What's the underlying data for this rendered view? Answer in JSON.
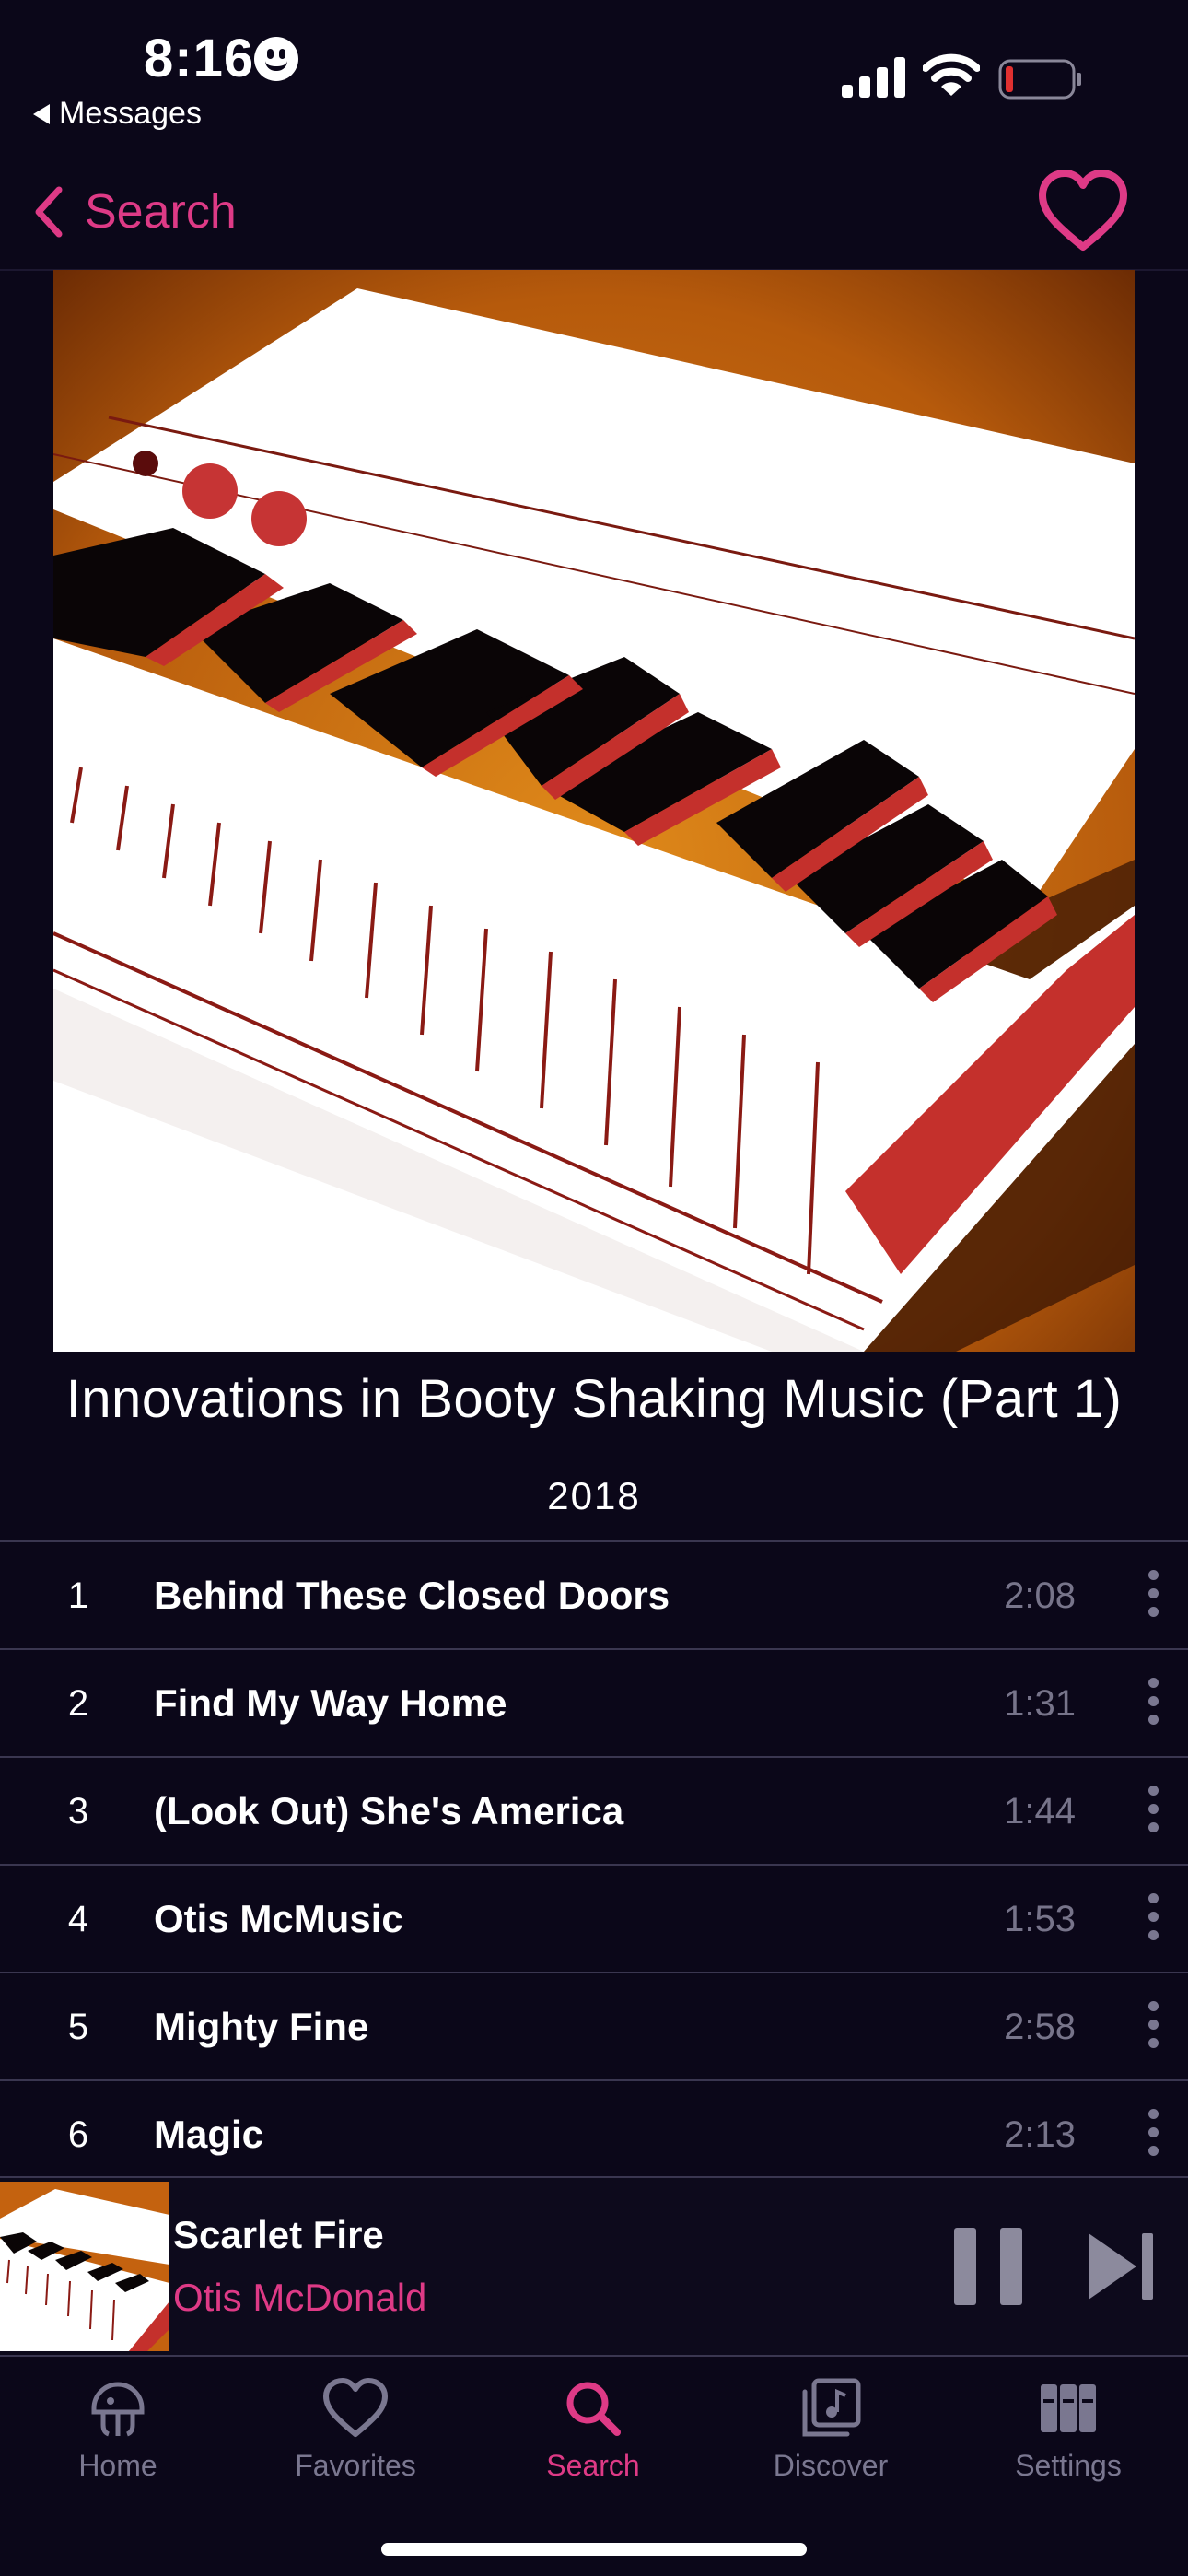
{
  "status_bar": {
    "time": "8:16",
    "back_app": "Messages"
  },
  "nav": {
    "back_label": "Search"
  },
  "album": {
    "title": "Innovations in Booty Shaking Music (Part 1)",
    "year": "2018"
  },
  "tracks": [
    {
      "number": "1",
      "title": "Behind These Closed Doors",
      "duration": "2:08"
    },
    {
      "number": "2",
      "title": "Find My Way Home",
      "duration": "1:31"
    },
    {
      "number": "3",
      "title": "(Look Out) She's America",
      "duration": "1:44"
    },
    {
      "number": "4",
      "title": "Otis McMusic",
      "duration": "1:53"
    },
    {
      "number": "5",
      "title": "Mighty Fine",
      "duration": "2:58"
    },
    {
      "number": "6",
      "title": "Magic",
      "duration": "2:13"
    }
  ],
  "now_playing": {
    "title": "Scarlet Fire",
    "artist": "Otis McDonald"
  },
  "tab_bar": {
    "items": [
      {
        "label": "Home",
        "icon": "jellyfish-icon"
      },
      {
        "label": "Favorites",
        "icon": "heart-icon"
      },
      {
        "label": "Search",
        "icon": "search-icon",
        "active": true
      },
      {
        "label": "Discover",
        "icon": "music-library-icon"
      },
      {
        "label": "Settings",
        "icon": "books-icon"
      }
    ]
  },
  "colors": {
    "accent": "#de3a86",
    "background": "#0b0719",
    "muted": "#7a7790"
  }
}
